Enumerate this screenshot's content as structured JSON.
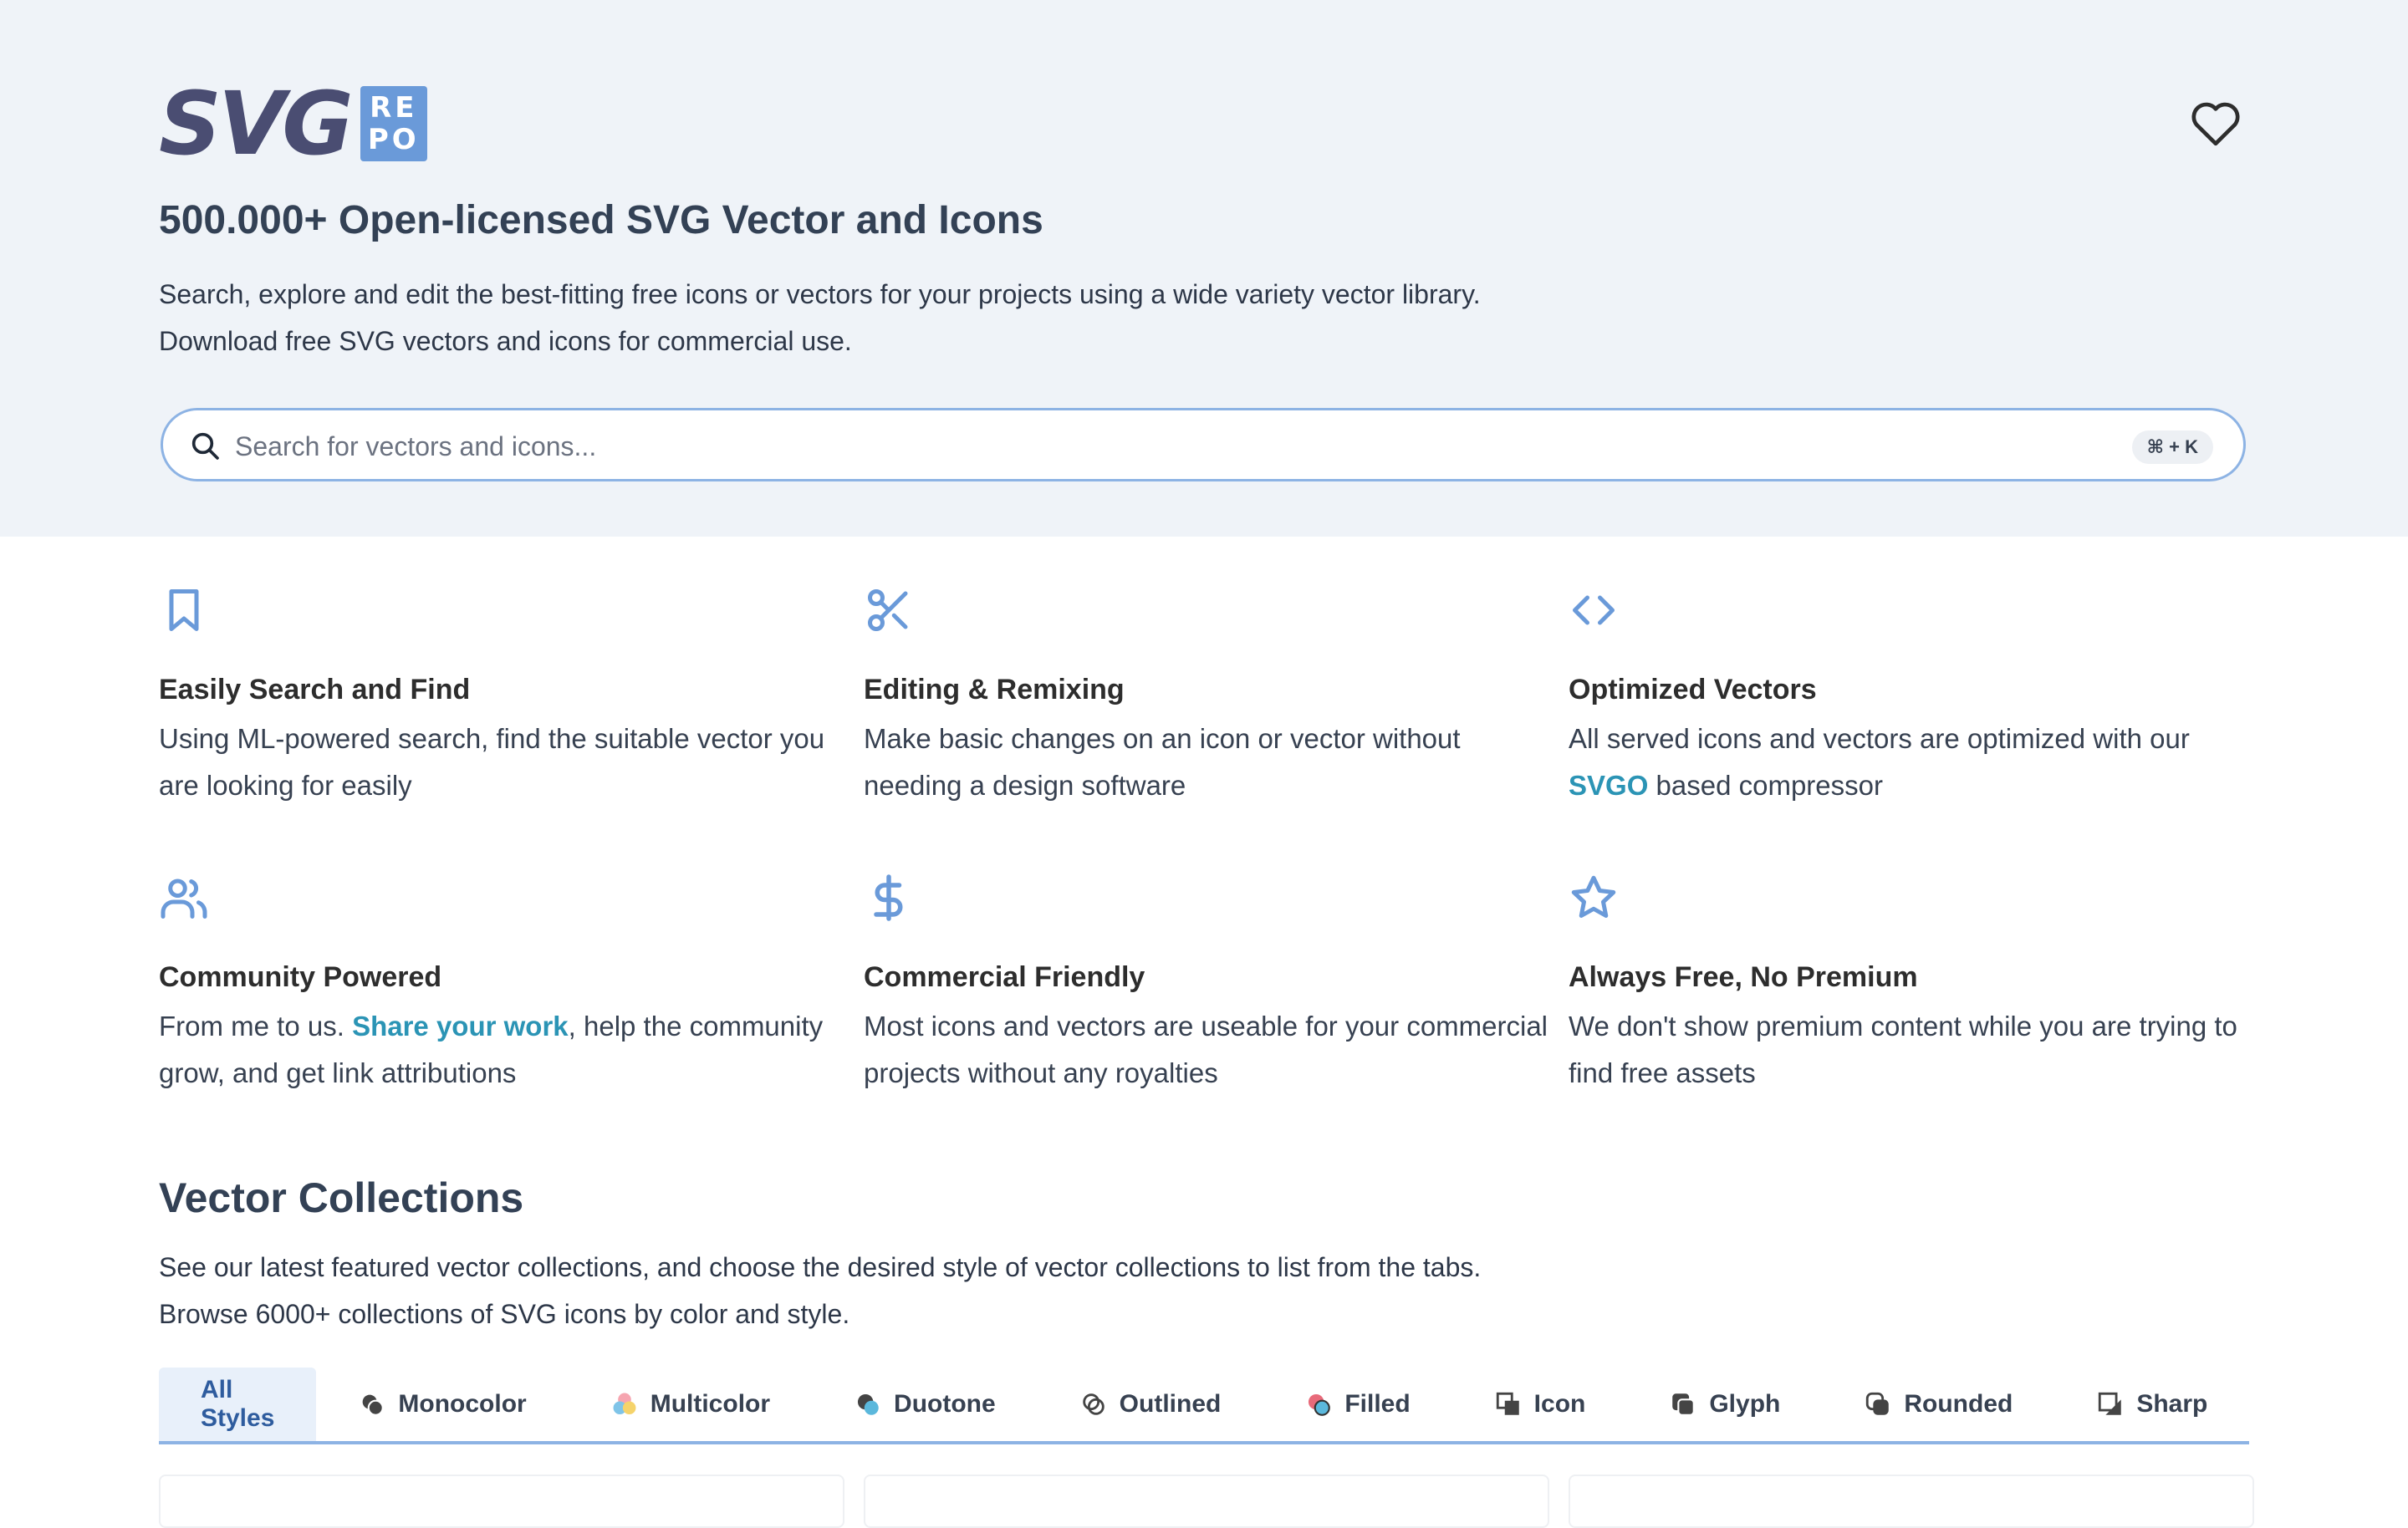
{
  "logo": {
    "text": "SVG",
    "badge_top": "RE",
    "badge_bottom": "PO"
  },
  "hero": {
    "title": "500.000+ Open-licensed SVG Vector and Icons",
    "desc_line1": "Search, explore and edit the best-fitting free icons or vectors for your projects using a wide variety vector library.",
    "desc_line2": "Download free SVG vectors and icons for commercial use."
  },
  "search": {
    "placeholder": "Search for vectors and icons...",
    "shortcut": "⌘ + K"
  },
  "features": [
    {
      "icon": "bookmark-icon",
      "title": "Easily Search and Find",
      "text": "Using ML-powered search, find the suitable vector you are looking for easily"
    },
    {
      "icon": "scissors-icon",
      "title": "Editing & Remixing",
      "text": "Make basic changes on an icon or vector without needing a design software"
    },
    {
      "icon": "code-icon",
      "title": "Optimized Vectors",
      "text_before": "All served icons and vectors are optimized with our",
      "link": "SVGO",
      "text_after": "based compressor"
    },
    {
      "icon": "users-icon",
      "title": "Community Powered",
      "text_before": "From me to us.",
      "link": "Share your work",
      "text_after": ", help the community grow, and get link attributions"
    },
    {
      "icon": "dollar-icon",
      "title": "Commercial Friendly",
      "text": "Most icons and vectors are useable for your commercial projects without any royalties"
    },
    {
      "icon": "star-icon",
      "title": "Always Free, No Premium",
      "text": "We don't show premium content while you are trying to find free assets"
    }
  ],
  "collections": {
    "title": "Vector Collections",
    "desc_line1": "See our latest featured vector collections, and choose the desired style of vector collections to list from the tabs.",
    "desc_line2": "Browse 6000+ collections of SVG icons by color and style.",
    "tabs": [
      {
        "label": "All Styles",
        "icon": ""
      },
      {
        "label": "Monocolor",
        "icon": "monocolor-icon"
      },
      {
        "label": "Multicolor",
        "icon": "multicolor-icon"
      },
      {
        "label": "Duotone",
        "icon": "duotone-icon"
      },
      {
        "label": "Outlined",
        "icon": "outlined-icon"
      },
      {
        "label": "Filled",
        "icon": "filled-icon"
      },
      {
        "label": "Icon",
        "icon": "icon-style-icon"
      },
      {
        "label": "Glyph",
        "icon": "glyph-icon"
      },
      {
        "label": "Rounded",
        "icon": "rounded-icon"
      },
      {
        "label": "Sharp",
        "icon": "sharp-icon"
      }
    ],
    "active_tab": "All Styles"
  },
  "colors": {
    "accent": "#6a9ad9",
    "link": "#2b94b5",
    "hero_bg": "#eff3f8",
    "logo": "#4a4d72"
  }
}
